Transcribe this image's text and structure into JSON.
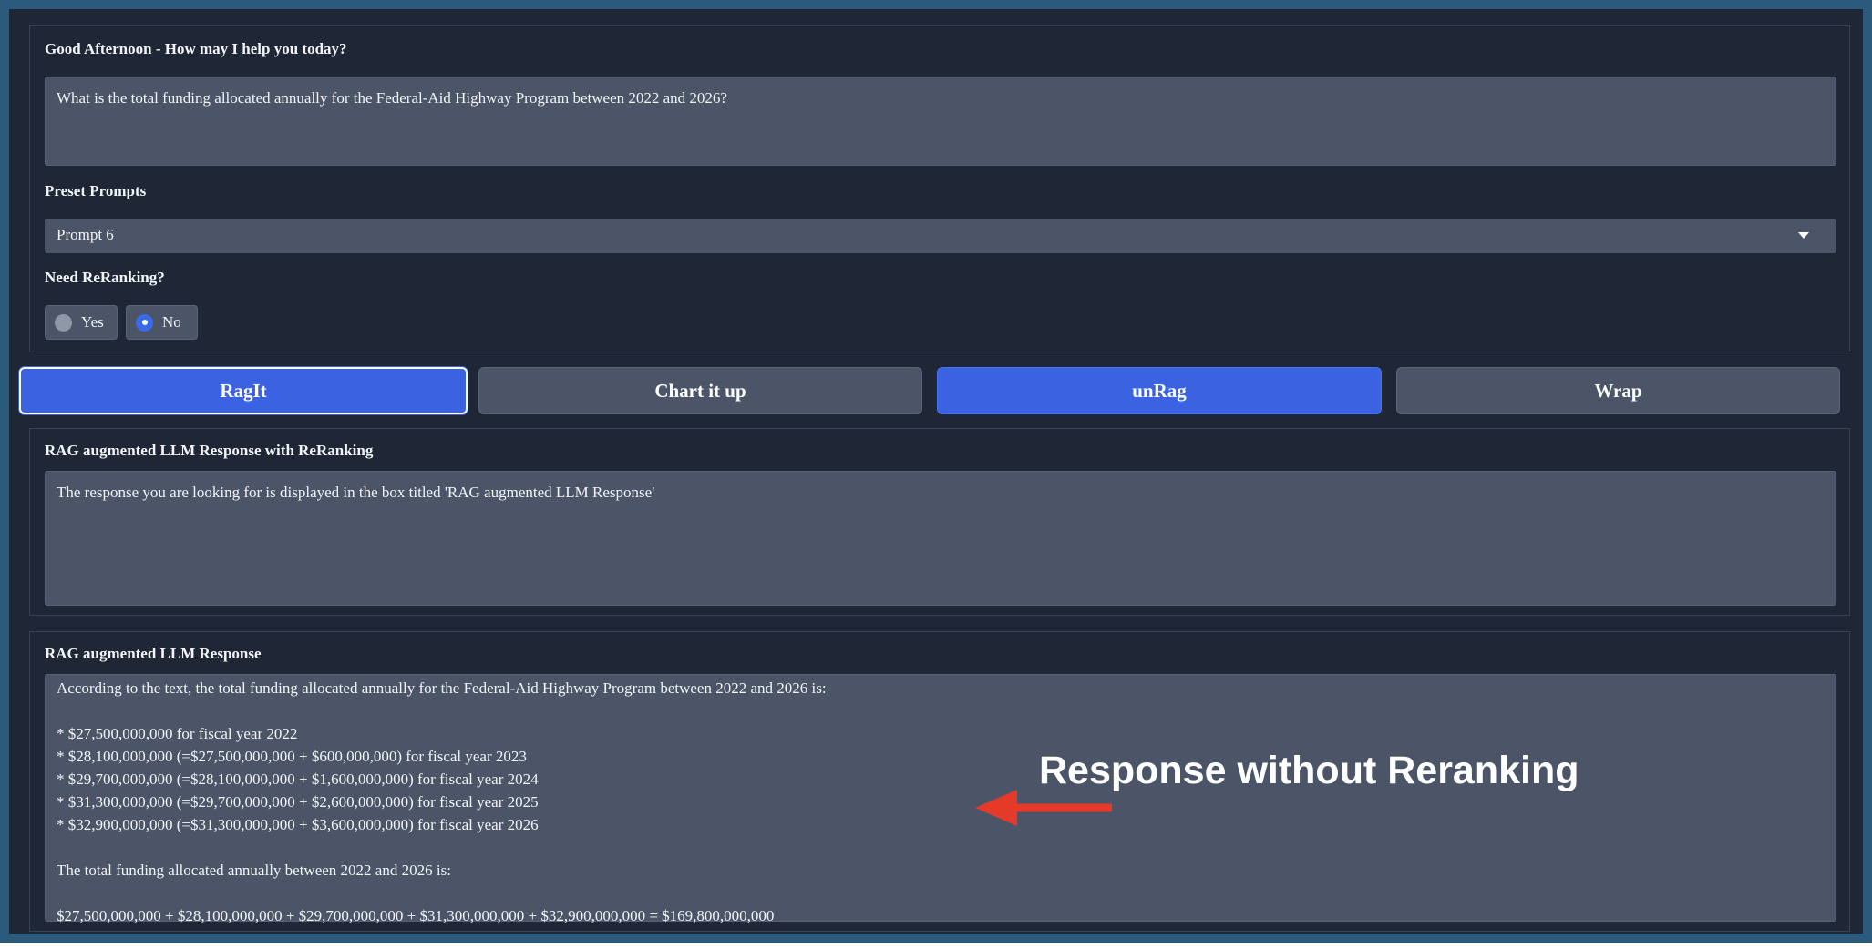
{
  "query": {
    "label": "Good Afternoon - How may I help you today?",
    "value": "What is the total funding allocated annually for the Federal-Aid Highway Program between 2022 and 2026?"
  },
  "preset": {
    "label": "Preset Prompts",
    "selected": "Prompt 6"
  },
  "rerank": {
    "label": "Need ReRanking?",
    "options": [
      {
        "label": "Yes",
        "selected": false
      },
      {
        "label": "No",
        "selected": true
      }
    ]
  },
  "buttons": {
    "ragit": "RagIt",
    "chart": "Chart it up",
    "unrag": "unRag",
    "wrap": "Wrap"
  },
  "rerank_response": {
    "label": "RAG augmented LLM Response with ReRanking",
    "text": "The response you are looking for is displayed in the box titled 'RAG augmented LLM Response'"
  },
  "response": {
    "label": "RAG augmented LLM Response",
    "lines": [
      "According to the text, the total funding allocated annually for the Federal-Aid Highway Program between 2022 and 2026 is:",
      "",
      "* $27,500,000,000 for fiscal year 2022",
      "* $28,100,000,000 (=$27,500,000,000 + $600,000,000) for fiscal year 2023",
      "* $29,700,000,000 (=$28,100,000,000 + $1,600,000,000) for fiscal year 2024",
      "* $31,300,000,000 (=$29,700,000,000 + $2,600,000,000) for fiscal year 2025",
      "* $32,900,000,000 (=$31,300,000,000 + $3,600,000,000) for fiscal year 2026",
      "",
      "The total funding allocated annually between 2022 and 2026 is:",
      "",
      "$27,500,000,000 + $28,100,000,000 + $29,700,000,000 + $31,300,000,000 + $32,900,000,000 = $169,800,000,000"
    ]
  },
  "annotation": {
    "text": "Response without Reranking",
    "arrow_color": "#e53a2a"
  }
}
